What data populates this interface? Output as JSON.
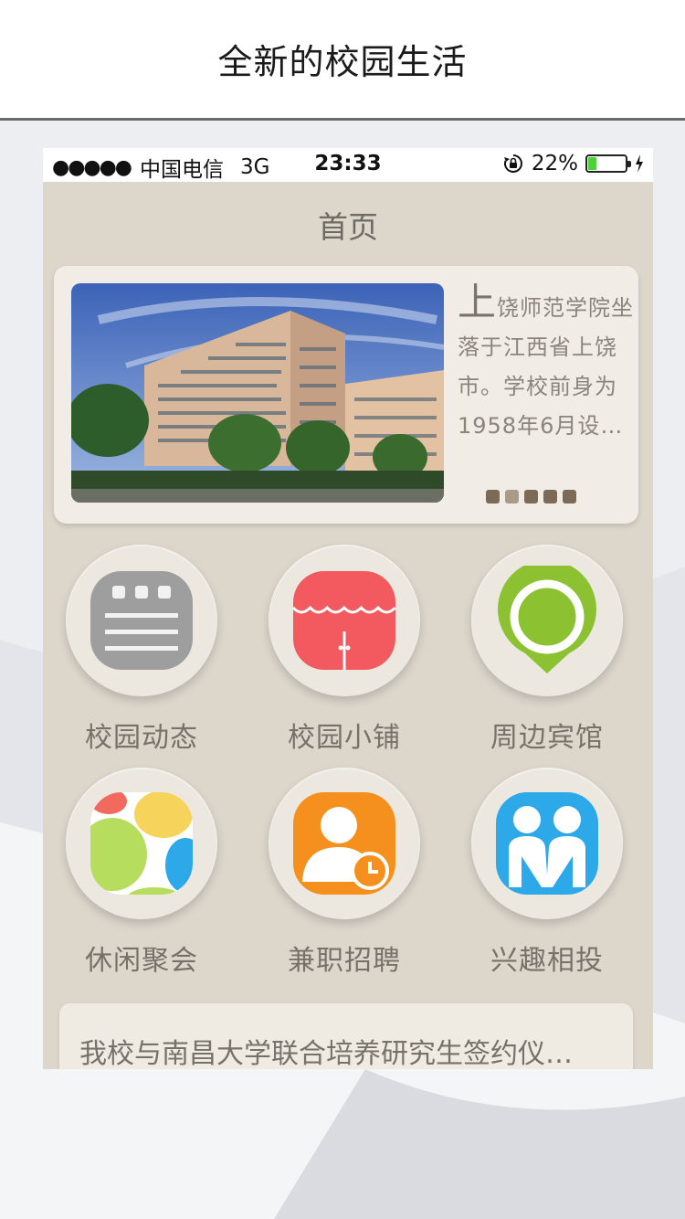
{
  "promo": {
    "title": "全新的校园生活"
  },
  "status_bar": {
    "signal": "●●●●●",
    "carrier": "中国电信",
    "network": "3G",
    "time": "23:33",
    "battery_percent": "22%",
    "battery_level": 0.22
  },
  "nav": {
    "title": "首页"
  },
  "banner": {
    "lead_char": "上",
    "text_line1": "饶师范学院坐",
    "text_line2": "落于江西省上饶",
    "text_line3": "市。学校前身为",
    "text_line4": "1958年6月设…",
    "page_count": 5
  },
  "grid": {
    "items": [
      {
        "label": "校园动态",
        "icon": "news-list-icon",
        "color": "#9e9e9e"
      },
      {
        "label": "校园小铺",
        "icon": "shop-awning-icon",
        "color": "#f25a5f"
      },
      {
        "label": "周边宾馆",
        "icon": "location-pin-icon",
        "color": "#8cc232"
      },
      {
        "label": "休闲聚会",
        "icon": "colorful-bubbles-icon",
        "color": "#f6d35a"
      },
      {
        "label": "兼职招聘",
        "icon": "person-clock-icon",
        "color": "#f5901e"
      },
      {
        "label": "兴趣相投",
        "icon": "two-people-icon",
        "color": "#2da9ea"
      }
    ]
  },
  "news": {
    "headline": "我校与南昌大学联合培养研究生签约仪…"
  }
}
